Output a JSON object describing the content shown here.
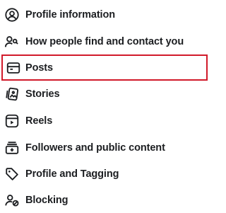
{
  "accent_color": "#d11a2a",
  "text_color": "#1c1e21",
  "menu": {
    "items": [
      {
        "label": "Profile information",
        "icon": "user-circle-icon"
      },
      {
        "label": "How people find and contact you",
        "icon": "people-search-icon"
      },
      {
        "label": "Posts",
        "icon": "posts-icon",
        "highlighted": true
      },
      {
        "label": "Stories",
        "icon": "stories-icon"
      },
      {
        "label": "Reels",
        "icon": "reels-icon"
      },
      {
        "label": "Followers and public content",
        "icon": "followers-icon"
      },
      {
        "label": "Profile and Tagging",
        "icon": "tag-icon"
      },
      {
        "label": "Blocking",
        "icon": "block-user-icon"
      }
    ]
  }
}
